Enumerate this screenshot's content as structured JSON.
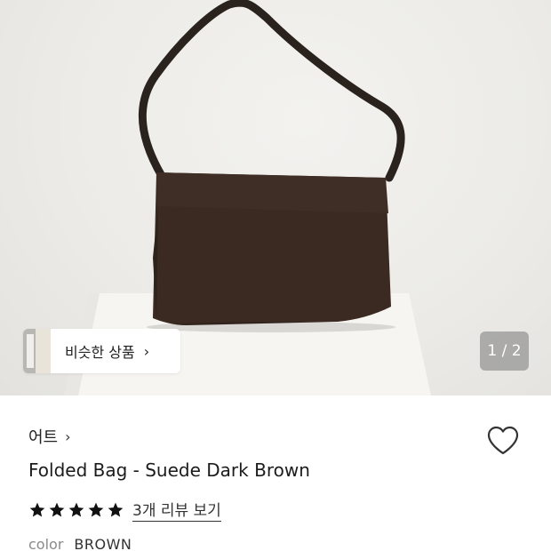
{
  "product_image": {
    "alt_icon": "product-photo"
  },
  "similar_products": {
    "label": "비슷한 상품",
    "arrow": "›"
  },
  "pager": {
    "text": "1 / 2"
  },
  "brand": {
    "name": "어트",
    "arrow": "›"
  },
  "product": {
    "title": "Folded Bag - Suede Dark Brown",
    "rating_stars": 5,
    "review_link": "3개 리뷰 보기"
  },
  "option": {
    "label": "color",
    "value": "BROWN"
  },
  "colors": {
    "bag": "#3a2a22",
    "star": "#111111",
    "heart_stroke": "#333333"
  }
}
